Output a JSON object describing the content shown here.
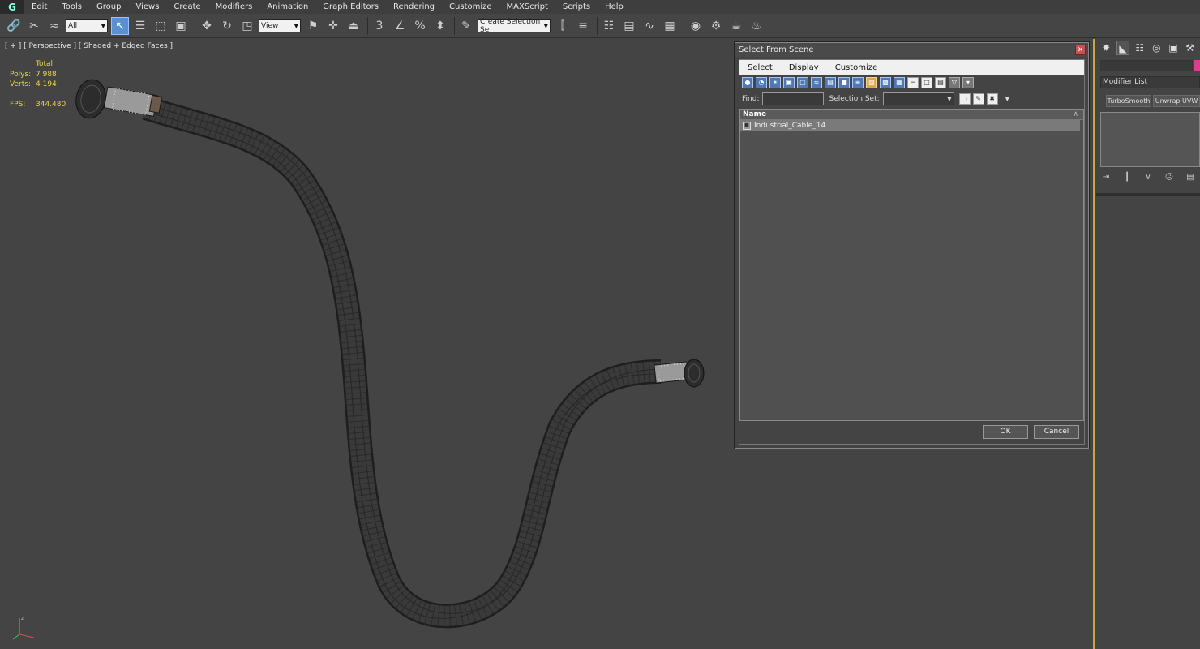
{
  "menubar": {
    "items": [
      "Edit",
      "Tools",
      "Group",
      "Views",
      "Create",
      "Modifiers",
      "Animation",
      "Graph Editors",
      "Rendering",
      "Customize",
      "MAXScript",
      "Scripts",
      "Help"
    ]
  },
  "toolbar": {
    "filter_value": "All",
    "refcoord_value": "View",
    "selection_set_placeholder": "Create Selection Se"
  },
  "viewport": {
    "label": "[ + ] [ Perspective ] [ Shaded + Edged Faces ]",
    "stats": {
      "total_label": "Total",
      "polys_label": "Polys:",
      "polys_value": "7 988",
      "verts_label": "Verts:",
      "verts_value": "4 194",
      "fps_label": "FPS:",
      "fps_value": "344.480"
    },
    "accent_color": "#c9a73c"
  },
  "dialog": {
    "title": "Select From Scene",
    "menu": [
      "Select",
      "Display",
      "Customize"
    ],
    "find_label": "Find:",
    "selection_set_label": "Selection Set:",
    "column_name": "Name",
    "rows": [
      "Industrial_Cable_14"
    ],
    "ok_label": "OK",
    "cancel_label": "Cancel"
  },
  "command_panel": {
    "modifier_list": "Modifier List",
    "buttons": [
      "TurboSmooth",
      "Unwrap UVW"
    ],
    "swatch_color": "#e23a8f"
  }
}
